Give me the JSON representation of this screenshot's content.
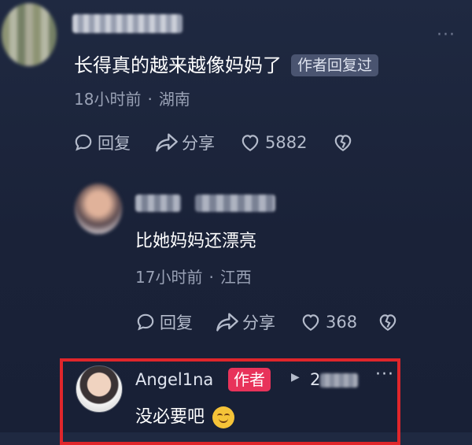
{
  "comment": {
    "text": "长得真的越来越像妈妈了",
    "author_reply_tag": "作者回复过",
    "time": "18小时前",
    "separator": "·",
    "location": "湖南",
    "actions": {
      "reply": "回复",
      "share": "分享",
      "likes": "5882"
    },
    "more": "···"
  },
  "reply": {
    "text": "比她妈妈还漂亮",
    "time": "17小时前",
    "separator": "·",
    "location": "江西",
    "actions": {
      "reply": "回复",
      "share": "分享",
      "likes": "368"
    }
  },
  "author_reply": {
    "username": "Angel1na",
    "badge": "作者",
    "time_visible": "2",
    "text": "没必要吧",
    "emoji": "smile-emoji",
    "more": "···"
  },
  "colors": {
    "background": "#1f2941",
    "author_badge": "#e8335a",
    "highlight_border": "#e0262b",
    "secondary_text": "#99a1b5"
  }
}
